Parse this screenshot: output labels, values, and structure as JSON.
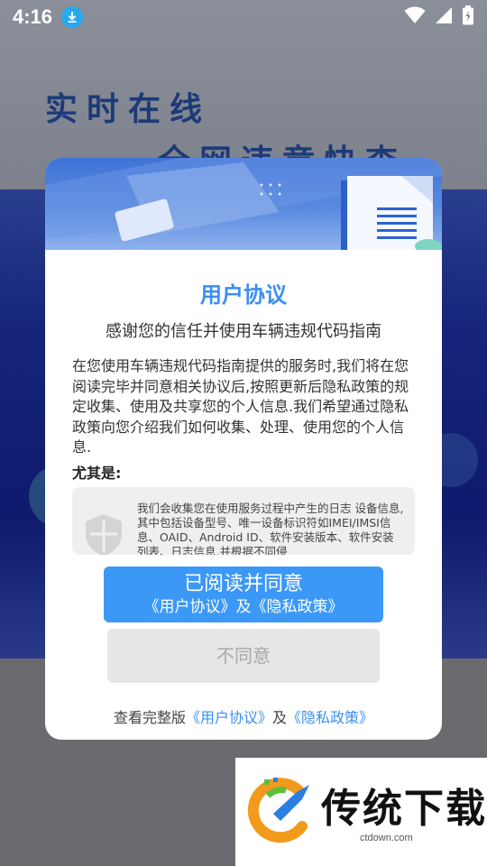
{
  "status_bar": {
    "time": "4:16"
  },
  "background": {
    "headline_1": "实时在线",
    "headline_2": "全网违章快查"
  },
  "dialog": {
    "title": "用户协议",
    "subtitle": "感谢您的信任并使用车辆违规代码指南",
    "body": "在您使用车辆违规代码指南提供的服务时,我们将在您阅读完毕并同意相关协议后,按照更新后隐私政策的规定收集、使用及共享您的个人信息.我们希望通过隐私政策向您介绍我们如何收集、处理、使用您的个人信息.",
    "emphasis_label": "尤其是:",
    "policy_excerpt": "我们会收集您在使用服务过程中产生的日志 设备信息,其中包括设备型号、唯一设备标识符如IMEI/IMSI信息、OAID、Android ID、软件安装版本、软件安装列表、日志信息,并根据不同侵",
    "agree_main": "已阅读并同意",
    "agree_sub": "《用户协议》及《隐私政策》",
    "disagree": "不同意",
    "footer_prefix": "查看完整版",
    "footer_link_1": "《用户协议》",
    "footer_mid": "及",
    "footer_link_2": "《隐私政策》"
  },
  "watermark": {
    "name": "传统下载",
    "url": "ctdown.com"
  },
  "colors": {
    "accent": "#3c98f6",
    "title_blue": "#3b8ff0",
    "disabled_bg": "#e6e6e6"
  }
}
